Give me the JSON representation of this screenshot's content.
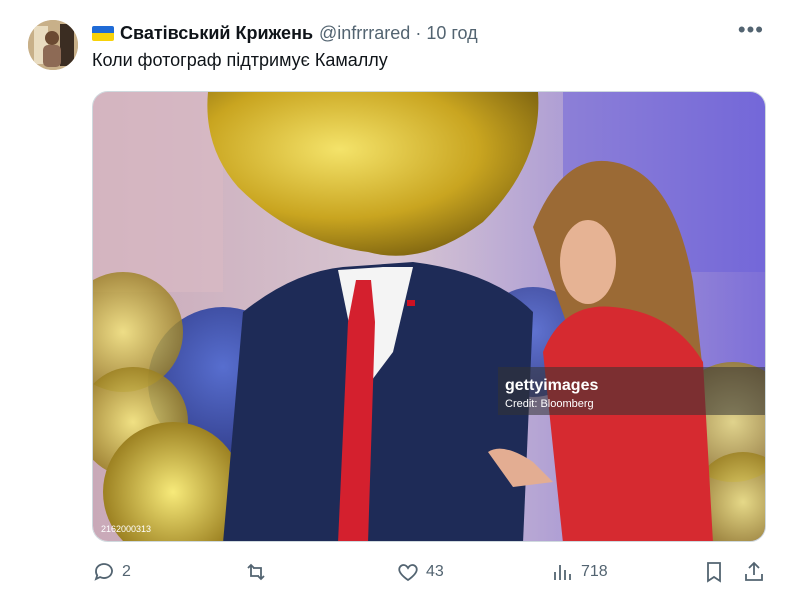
{
  "author": {
    "name": "Сватівський Крижень",
    "handle": "@infrrrared",
    "separator": "·",
    "time": "10 год",
    "flag_colors": [
      "#1f6bd6",
      "#f7d20a"
    ]
  },
  "tweet": {
    "text": "Коли фотограф підтримує Камаллу"
  },
  "media": {
    "watermark_brand": "gettyimages",
    "watermark_credit": "Credit: Bloomberg",
    "image_id": "2162000313"
  },
  "actions": {
    "replies": "2",
    "retweets": "",
    "likes": "43",
    "views": "718"
  },
  "icons": [
    "reply-icon",
    "retweet-icon",
    "like-icon",
    "views-icon",
    "bookmark-icon",
    "share-icon",
    "more-icon"
  ]
}
